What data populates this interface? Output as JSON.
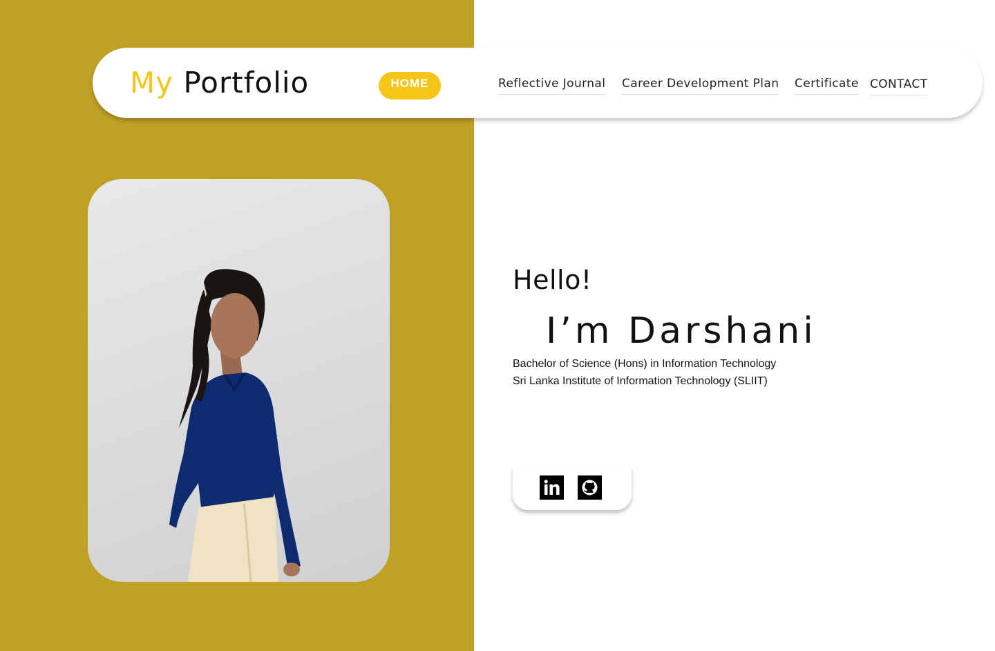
{
  "colors": {
    "panel_mustard": "#c1a026",
    "accent_yellow": "#f5c518",
    "text": "#111111",
    "background": "#ffffff"
  },
  "header": {
    "logo_prefix": "My",
    "logo_suffix": "Portfolio",
    "home_label": "HOME",
    "nav_links": [
      "Reflective Journal",
      "Career Development Plan",
      "Certificate",
      "CONTACT"
    ]
  },
  "hero": {
    "greeting": "Hello!",
    "name_line": "I’m Darshani",
    "degree": "Bachelor of Science (Hons) in Information Technology",
    "institution": "Sri Lanka Institute of Information Technology (SLIIT)"
  },
  "social": [
    {
      "name": "LinkedIn",
      "icon": "linkedin-icon"
    },
    {
      "name": "GitHub",
      "icon": "github-icon"
    }
  ]
}
